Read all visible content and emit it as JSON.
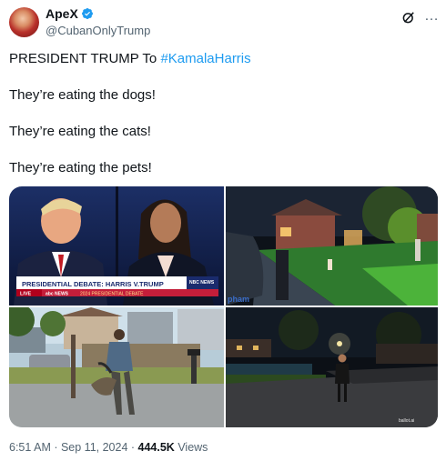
{
  "author": {
    "name": "ApeX",
    "handle": "@CubanOnlyTrump",
    "verified": true,
    "badge_color": "#1d9bf0"
  },
  "header_icons": {
    "grok": "grok-icon",
    "more": "…"
  },
  "tweet": {
    "line1_prefix": "PRESIDENT TRUMP To ",
    "line1_hashtag": "#KamalaHarris",
    "line2": "They’re eating the dogs!",
    "line3": "They’re eating the cats!",
    "line4": "They’re eating the pets!"
  },
  "media": {
    "debate_banner": "PRESIDENTIAL DEBATE: HARRIS V.TRUMP",
    "network": "NBC NEWS",
    "live_tag": "LIVE",
    "abc_label": "abc NEWS",
    "year_label": "2024 PRESIDENTIAL DEBATE",
    "photo2_overlay": "pham",
    "photo4_credit": "ballot.ai"
  },
  "meta": {
    "time": "6:51 AM · Sep 11, 2024 · ",
    "views_count": "444.5K",
    "views_label": " Views"
  }
}
